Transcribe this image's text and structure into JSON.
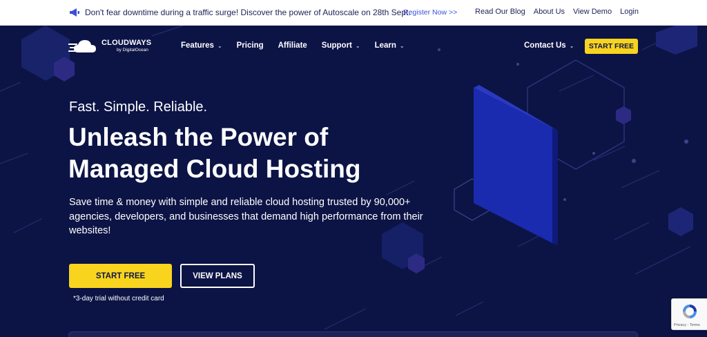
{
  "topbar": {
    "announcement": "Don't fear downtime during a traffic surge! Discover the power of Autoscale on 28th Sept.",
    "register_label": "Register Now >>",
    "links": [
      "Read Our Blog",
      "About Us",
      "View Demo",
      "Login"
    ]
  },
  "logo": {
    "name": "CLOUDWAYS",
    "sub": "by DigitalOcean"
  },
  "nav": {
    "items": [
      {
        "label": "Features",
        "chevron": "⌄"
      },
      {
        "label": "Pricing",
        "chevron": ""
      },
      {
        "label": "Affiliate",
        "chevron": ""
      },
      {
        "label": "Support",
        "chevron": "⌄"
      },
      {
        "label": "Learn",
        "chevron": "⌄"
      }
    ],
    "contact_label": "Contact Us",
    "contact_chevron": "⌄",
    "start_label": "START FREE"
  },
  "hero": {
    "tagline": "Fast. Simple. Reliable.",
    "headline_line1": "Unleash the Power of",
    "headline_line2": "Managed Cloud Hosting",
    "description": "Save time & money with simple and reliable cloud hosting trusted by 90,000+ agencies, developers, and businesses that demand high performance from their websites!",
    "start_label": "START FREE",
    "plans_label": "VIEW PLANS",
    "trial_note": "*3-day trial without credit card"
  },
  "recaptcha": {
    "links": "Privacy - Terms"
  },
  "colors": {
    "background": "#0c1446",
    "accent": "#f8d41e",
    "link": "#3b4fd8"
  },
  "icons": [
    "megaphone-icon",
    "cloudways-logo-icon",
    "chevron-down-icon",
    "recaptcha-icon"
  ]
}
